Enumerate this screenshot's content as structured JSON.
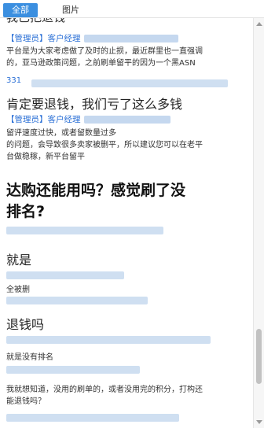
{
  "tabs": [
    {
      "label": "全部"
    },
    {
      "label": "图片"
    }
  ],
  "thread": {
    "cut_heading": "我已把退钱",
    "admin1": "【管理员】客户经理",
    "msg1_line1": "平台是为大家考虑做了及时的止损，最近群里也一直强调",
    "msg1_line2": "的，亚马逊政策问题，之前刷单留平的因为一个黑ASN",
    "msg1_num": "331",
    "heading1": "肯定要退钱，我们亏了这么多钱",
    "admin2": "【管理员】客户经理",
    "msg2_line1": "留评速度过快，或者留数量过多",
    "msg2_line2": "的问题，会导致很多卖家被删平，所以建议您可以在老平",
    "msg2_line3": "台做稳稼，新平台留平",
    "heading2_line1": "达购还能用吗？感觉刷了没",
    "heading2_line2": "排名?",
    "reply1": "就是",
    "reply1_sub": "全被删",
    "reply2": "退钱吗",
    "reply2_sub": "就是没有排名",
    "msg3_line1": "我就想知道，没用的刷单的，或者没用完的积分，打构还",
    "msg3_line2": "能退钱吗？"
  },
  "colors": {
    "tab_active": "#3b8fe0",
    "admin_blue": "#2a6fd6",
    "blur": "#cfdff1"
  }
}
